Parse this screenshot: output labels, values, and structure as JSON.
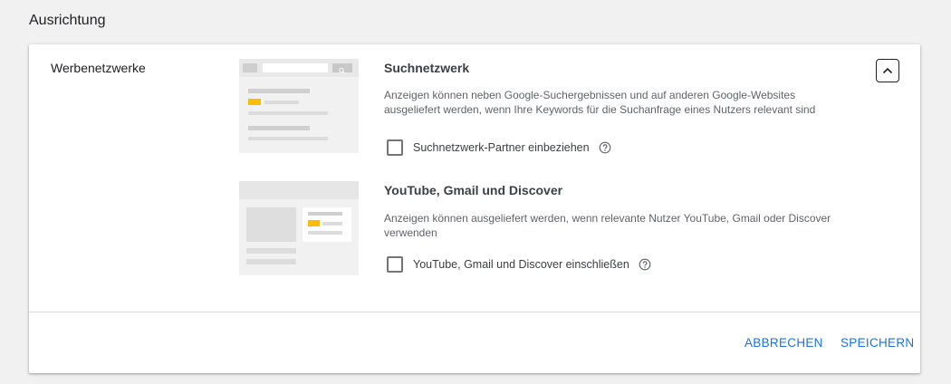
{
  "section": {
    "title": "Ausrichtung"
  },
  "networks": {
    "label": "Werbenetzwerke",
    "search": {
      "title": "Suchnetzwerk",
      "description": "Anzeigen können neben Google-Suchergebnissen und auf anderen Google-Websites ausgeliefert werden, wenn Ihre Keywords für die Suchanfrage eines Nutzers relevant sind",
      "checkbox_label": "Suchnetzwerk-Partner einbeziehen",
      "checked": false
    },
    "display": {
      "title": "YouTube, Gmail und Discover",
      "description": "Anzeigen können ausgeliefert werden, wenn relevante Nutzer YouTube, Gmail oder Discover verwenden",
      "checkbox_label": "YouTube, Gmail und Discover einschließen",
      "checked": false
    }
  },
  "actions": {
    "cancel": "ABBRECHEN",
    "save": "SPEICHERN"
  },
  "colors": {
    "accent": "#1a73e8",
    "ad_highlight": "#fbbc04",
    "background": "#f1f1f1"
  },
  "icons": {
    "collapse": "chevron-up-icon",
    "help": "help-circle-icon",
    "search": "magnifier-icon"
  }
}
